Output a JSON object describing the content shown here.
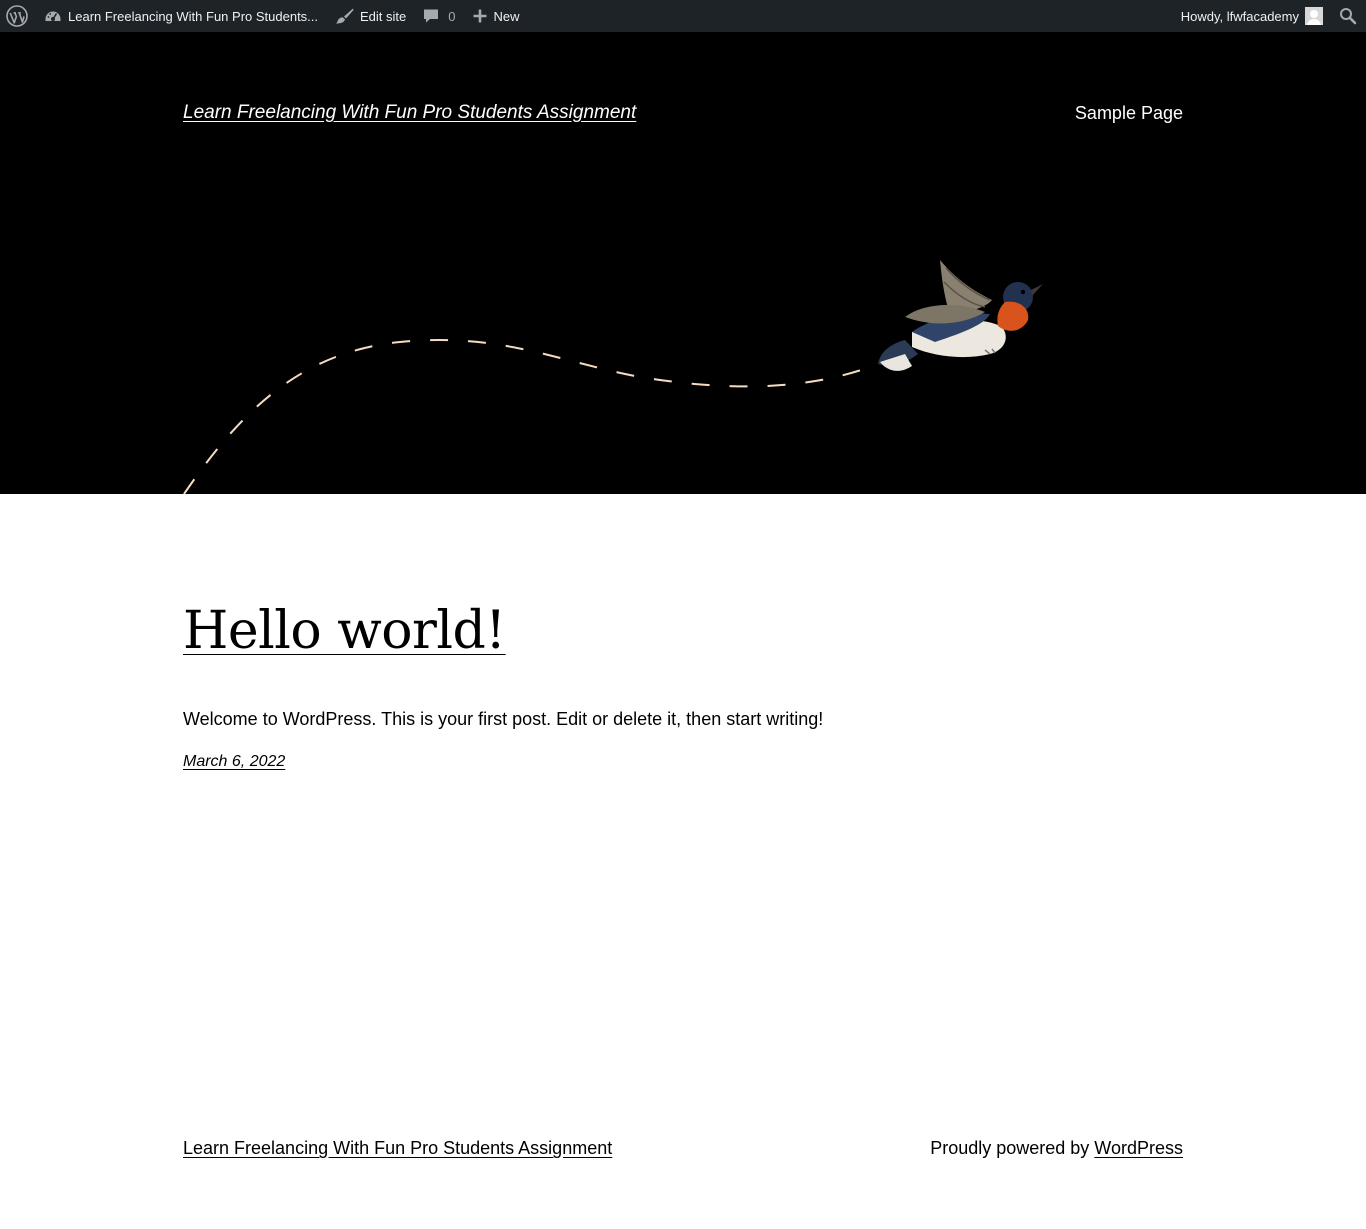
{
  "admin_bar": {
    "site_name": "Learn Freelancing With Fun Pro Students...",
    "edit_site": "Edit site",
    "comments_count": "0",
    "new_label": "New",
    "howdy": "Howdy, lfwfacademy"
  },
  "header": {
    "site_title": "Learn Freelancing With Fun Pro Students Assignment",
    "nav": [
      {
        "label": "Sample Page"
      }
    ]
  },
  "post": {
    "title": "Hello world!",
    "excerpt": "Welcome to WordPress. This is your first post. Edit or delete it, then start writing!",
    "date": "March 6, 2022"
  },
  "footer": {
    "site_title": "Learn Freelancing With Fun Pro Students Assignment",
    "credit_prefix": "Proudly powered by ",
    "credit_link": "WordPress"
  },
  "colors": {
    "admin_bar_bg": "#1d2327",
    "header_bg": "#000000",
    "flight_path": "#f4dcc2"
  }
}
